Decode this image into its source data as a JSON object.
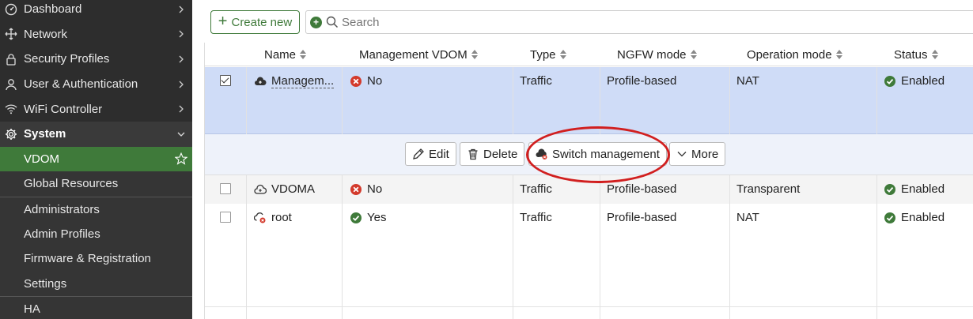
{
  "sidebar": {
    "items": [
      {
        "label": "Dashboard",
        "icon": "dashboard-icon"
      },
      {
        "label": "Network",
        "icon": "network-icon"
      },
      {
        "label": "Security Profiles",
        "icon": "lock-icon"
      },
      {
        "label": "User & Authentication",
        "icon": "user-icon"
      },
      {
        "label": "WiFi Controller",
        "icon": "wifi-icon"
      },
      {
        "label": "System",
        "icon": "gear-icon"
      }
    ],
    "system_children": [
      {
        "label": "VDOM"
      },
      {
        "label": "Global Resources"
      },
      {
        "label": "Administrators"
      },
      {
        "label": "Admin Profiles"
      },
      {
        "label": "Firmware & Registration"
      },
      {
        "label": "Settings"
      },
      {
        "label": "HA"
      }
    ]
  },
  "toolbar": {
    "create_label": "Create new",
    "search_placeholder": "Search"
  },
  "table": {
    "headers": [
      "Name",
      "Management VDOM",
      "Type",
      "NGFW mode",
      "Operation mode",
      "Status"
    ],
    "rows": [
      {
        "name": "Managem...",
        "mgmt": "No",
        "type": "Traffic",
        "ngfw": "Profile-based",
        "op": "NAT",
        "status": "Enabled"
      },
      {
        "name": "VDOMA",
        "mgmt": "No",
        "type": "Traffic",
        "ngfw": "Profile-based",
        "op": "Transparent",
        "status": "Enabled"
      },
      {
        "name": "root",
        "mgmt": "Yes",
        "type": "Traffic",
        "ngfw": "Profile-based",
        "op": "NAT",
        "status": "Enabled"
      }
    ]
  },
  "actions": {
    "edit": "Edit",
    "delete": "Delete",
    "switch": "Switch management",
    "more": "More"
  },
  "colors": {
    "accent": "#3f7a3a",
    "selected_row": "#cfdcf7",
    "error": "#d33a2c",
    "ok": "#3f7a3a",
    "annotation": "#d11f1f"
  }
}
